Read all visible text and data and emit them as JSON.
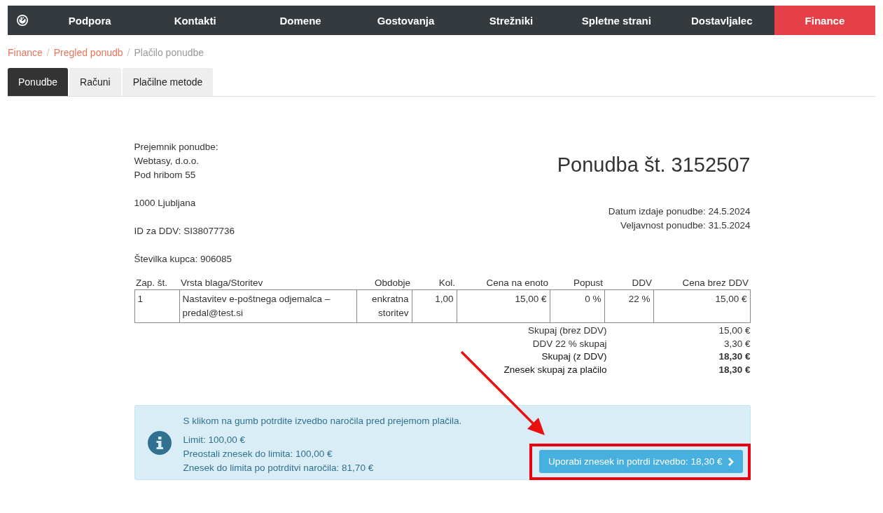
{
  "nav": {
    "items": [
      {
        "label": "Podpora",
        "selected": false
      },
      {
        "label": "Kontakti",
        "selected": false
      },
      {
        "label": "Domene",
        "selected": false
      },
      {
        "label": "Gostovanja",
        "selected": false
      },
      {
        "label": "Strežniki",
        "selected": false
      },
      {
        "label": "Spletne strani",
        "selected": false
      },
      {
        "label": "Dostavljalec",
        "selected": false
      },
      {
        "label": "Finance",
        "selected": true
      }
    ]
  },
  "breadcrumb": [
    {
      "label": "Finance",
      "current": false
    },
    {
      "separator": "/",
      "label": "Pregled ponudb",
      "current": false
    },
    {
      "separator": "/",
      "label": "Plačilo ponudbe",
      "current": true
    }
  ],
  "tabs": [
    {
      "label": "Ponudbe",
      "selected": true
    },
    {
      "label": "Računi",
      "selected": false
    },
    {
      "label": "Plačilne metode",
      "selected": false
    }
  ],
  "recipient": [
    [
      "Prejemnik ponudbe:",
      "Webtasy, d.o.o.",
      "Pod hribom 55"
    ],
    [
      "1000 Ljubljana"
    ],
    [
      "ID za DDV: SI38077736"
    ],
    [
      "Številka kupca: 906085"
    ]
  ],
  "offer": {
    "title": "Ponudba št. 3152507",
    "dates": [
      "Datum izdaje ponudbe: 24.5.2024",
      "Veljavnost ponudbe: 31.5.2024"
    ]
  },
  "table": {
    "columns": [
      "Zap. št.",
      "Vrsta blaga/Storitev",
      "Obdobje",
      "Kol.",
      "Cena na enoto",
      "Popust",
      "DDV",
      "Cena brez DDV"
    ],
    "rows": [
      [
        "1",
        "Nastavitev e-poštnega odjemalca – predal@test.si",
        "enkratna storitev",
        "1,00",
        "15,00 €",
        "0 %",
        "22 %",
        "15,00 €"
      ]
    ]
  },
  "totals": [
    {
      "label": "Skupaj (brez DDV)",
      "value": "15,00 €",
      "bold": false
    },
    {
      "label": "DDV 22 % skupaj",
      "value": "3,30 €",
      "bold": false
    },
    {
      "label": "Skupaj (z DDV)",
      "value": "18,30 €",
      "bold": true
    },
    {
      "label": "Znesek skupaj za plačilo",
      "value": "18,30 €",
      "bold": true
    }
  ],
  "info": {
    "message": "S klikom na gumb potrdite izvedbo naročila pred prejemom plačila.",
    "lines": [
      "Limit: 100,00 €",
      "Preostali znesek do limita: 100,00 €",
      "Znesek do limita po potrditvi naročila: 81,70 €"
    ],
    "button": "Uporabi znesek in potrdi izvedbo: 18,30 €"
  }
}
